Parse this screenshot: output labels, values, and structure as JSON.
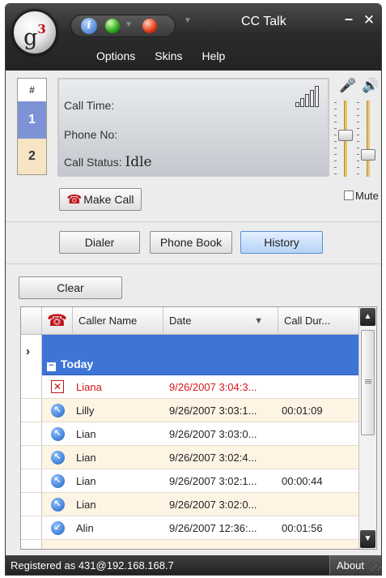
{
  "window": {
    "title": "CC Talk",
    "logo_text": "g",
    "logo_sup": "3"
  },
  "menu": [
    "Options",
    "Skins",
    "Help"
  ],
  "lines": {
    "header": "#",
    "line1": "1",
    "line2": "2"
  },
  "display": {
    "call_time_label": "Call Time:",
    "call_time_value": "",
    "phone_no_label": "Phone No:",
    "phone_no_value": "",
    "call_status_label": "Call Status:",
    "call_status_value": "Idle"
  },
  "buttons": {
    "make_call": "Make Call",
    "dialer": "Dialer",
    "phone_book": "Phone Book",
    "history": "History",
    "clear": "Clear",
    "mute": "Mute"
  },
  "volume": {
    "mic_level": 0.55,
    "speaker_level": 0.25
  },
  "history": {
    "columns": {
      "caller_name": "Caller Name",
      "date": "Date",
      "duration": "Call Dur..."
    },
    "group": "Today",
    "rows": [
      {
        "type": "missed",
        "name": "Liana",
        "date": "9/26/2007 3:04:3...",
        "duration": ""
      },
      {
        "type": "outgoing",
        "name": "Lilly",
        "date": "9/26/2007 3:03:1...",
        "duration": "00:01:09"
      },
      {
        "type": "outgoing",
        "name": "Lian",
        "date": "9/26/2007 3:03:0...",
        "duration": ""
      },
      {
        "type": "outgoing",
        "name": "Lian",
        "date": "9/26/2007 3:02:4...",
        "duration": ""
      },
      {
        "type": "outgoing",
        "name": "Lian",
        "date": "9/26/2007 3:02:1...",
        "duration": "00:00:44"
      },
      {
        "type": "outgoing",
        "name": "Lian",
        "date": "9/26/2007 3:02:0...",
        "duration": ""
      },
      {
        "type": "incoming",
        "name": "Alin",
        "date": "9/26/2007 12:36:...",
        "duration": "00:01:56"
      }
    ]
  },
  "status": {
    "registered": "Registered as 431@192.168.168.7",
    "about": "About"
  },
  "colors": {
    "accent": "#3d74d6",
    "missed": "#d8141a",
    "titlebar": "#2b2b2b"
  },
  "icons": {
    "info": "info-icon",
    "online": "green-status-icon",
    "offline": "red-status-icon",
    "phone": "phone-icon",
    "mic": "microphone-icon",
    "speaker": "speaker-icon",
    "missed": "missed-call-icon",
    "outgoing": "outgoing-call-icon",
    "incoming": "incoming-call-icon"
  }
}
